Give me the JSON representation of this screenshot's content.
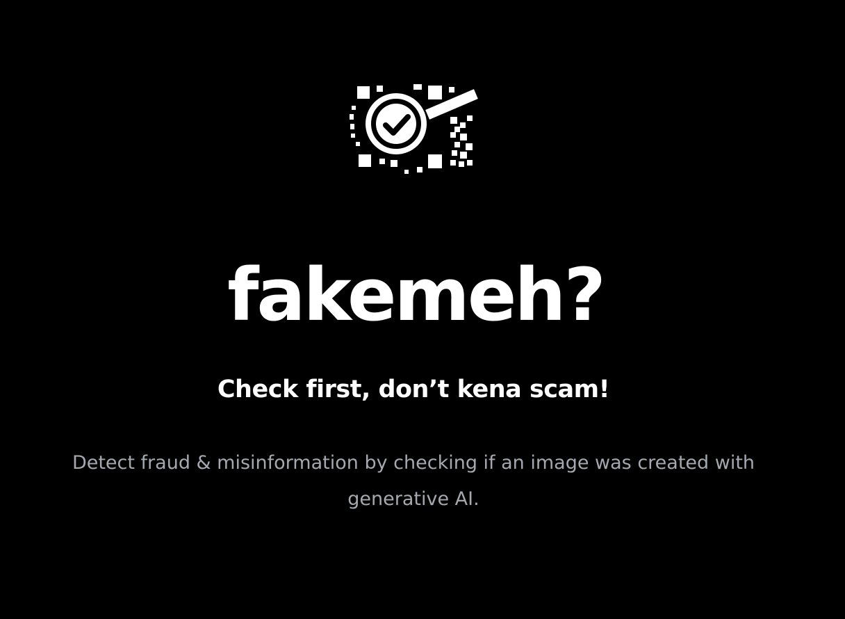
{
  "logo": {
    "icon": "magnifier-check-pixel-icon"
  },
  "hero": {
    "title": "fakemeh?",
    "tagline": "Check first, don’t kena scam!",
    "description": "Detect fraud & misinformation by checking if an image was created with generative AI."
  },
  "colors": {
    "background": "#000000",
    "title": "#ffffff",
    "tagline": "#ffffff",
    "description": "#a6a8b0"
  }
}
